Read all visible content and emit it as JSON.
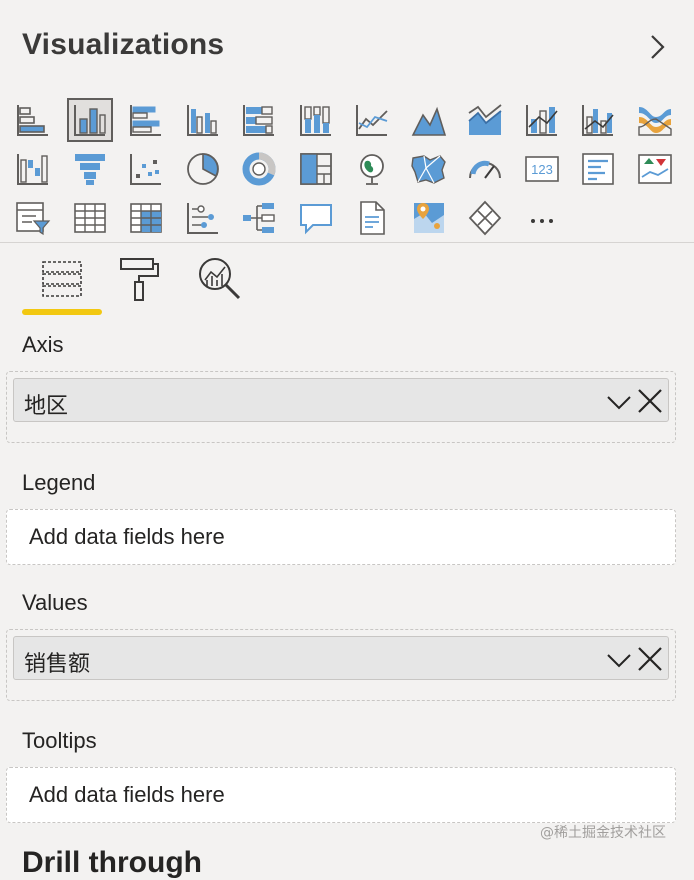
{
  "pane": {
    "title": "Visualizations",
    "expand_icon": "chevron-right-icon"
  },
  "visual_icons": [
    "stacked-bar-chart-icon",
    "stacked-column-chart-icon",
    "clustered-bar-chart-icon",
    "clustered-column-chart-icon",
    "100-percent-stacked-bar-icon",
    "100-percent-stacked-column-icon",
    "line-chart-icon",
    "area-chart-icon",
    "stacked-area-chart-icon",
    "line-and-stacked-column-icon",
    "line-and-clustered-column-icon",
    "ribbon-chart-icon",
    "waterfall-chart-icon",
    "funnel-chart-icon",
    "scatter-chart-icon",
    "pie-chart-icon",
    "donut-chart-icon",
    "treemap-icon",
    "map-icon",
    "filled-map-icon",
    "gauge-icon",
    "card-icon",
    "multi-row-card-icon",
    "kpi-icon",
    "slicer-icon",
    "table-icon",
    "matrix-icon",
    "key-influencers-icon",
    "decomposition-tree-icon",
    "qa-icon",
    "paginated-report-icon",
    "arcgis-map-icon",
    "power-apps-icon",
    "more-visuals-icon"
  ],
  "selected_visual": "stacked-column-chart-icon",
  "tabs": [
    "fields-tab-icon",
    "format-tab-icon",
    "analytics-tab-icon"
  ],
  "active_tab": "fields-tab-icon",
  "wells": {
    "axis": {
      "label": "Axis",
      "field": "地区"
    },
    "legend": {
      "label": "Legend",
      "placeholder": "Add data fields here"
    },
    "values": {
      "label": "Values",
      "field": "销售额"
    },
    "tooltips": {
      "label": "Tooltips",
      "placeholder": "Add data fields here"
    }
  },
  "next_section": "Drill through",
  "watermark": "@稀土掘金技术社区",
  "colors": {
    "accent_underline": "#f2c811",
    "icon_blue": "#5b9bd5",
    "icon_gray": "#605e5c"
  }
}
